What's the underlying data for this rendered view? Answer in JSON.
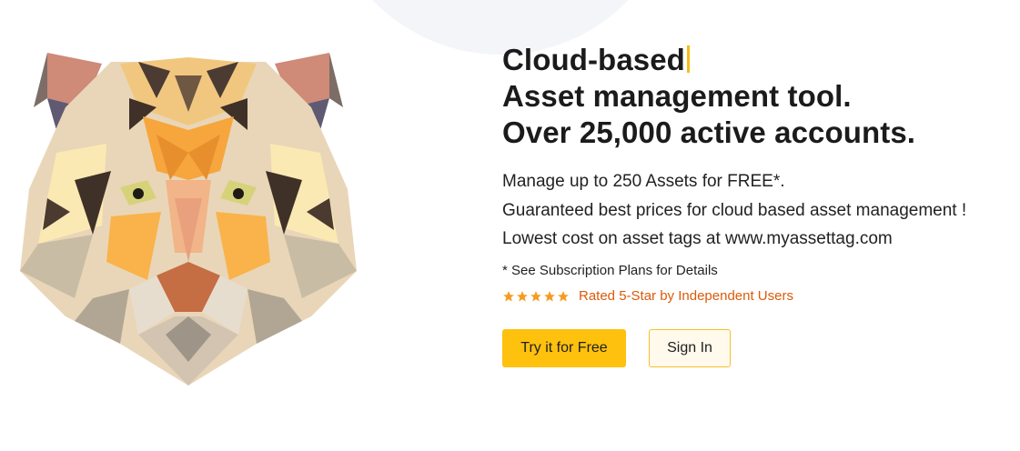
{
  "hero": {
    "illustration": "low-poly-tiger-head",
    "headline": {
      "line1": "Cloud-based",
      "line2": "Asset management tool.",
      "line3": "Over 25,000 active accounts."
    },
    "description": [
      "Manage up to 250 Assets for FREE*.",
      "Guaranteed best prices for cloud based asset management !",
      "Lowest cost on asset tags at www.myassettag.com"
    ],
    "footnote": "* See Subscription Plans for Details",
    "rating": {
      "stars": 5,
      "text": "Rated 5-Star by Independent Users"
    },
    "buttons": {
      "primary_label": "Try it for Free",
      "secondary_label": "Sign In"
    }
  },
  "colors": {
    "accent": "#fec10e",
    "rating_text": "#dc5a0b",
    "star": "#f79a21"
  }
}
